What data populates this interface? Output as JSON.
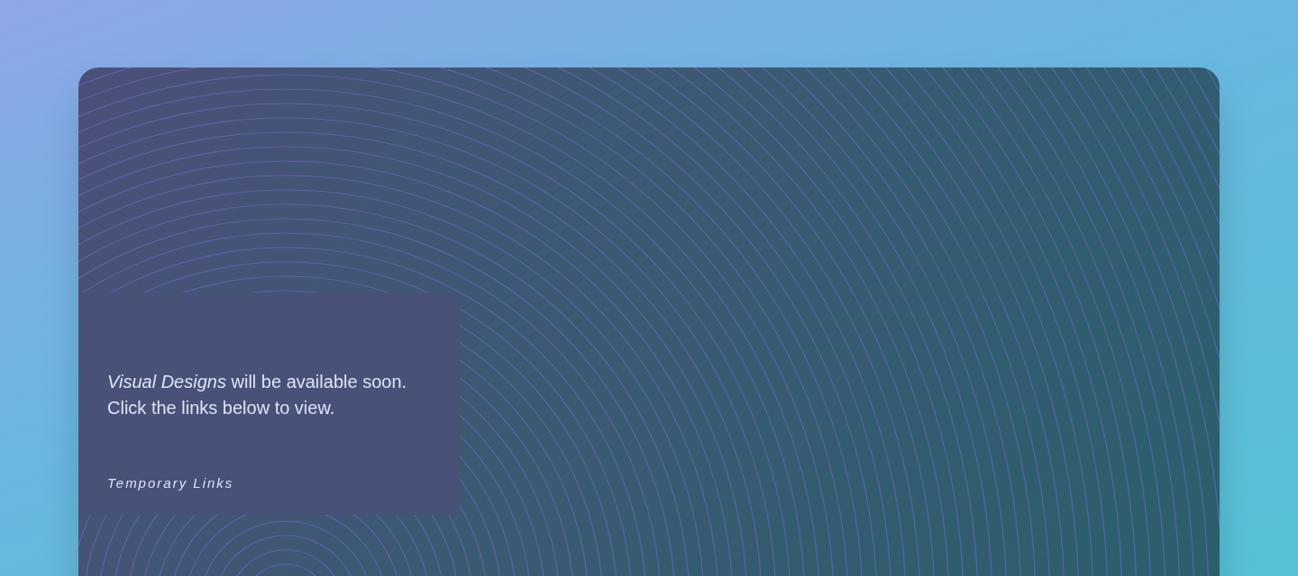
{
  "message_lines": [
    "*Visual Designs* will be available soon.",
    "Click the links below to view."
  ],
  "links_heading": "Temporary Links"
}
